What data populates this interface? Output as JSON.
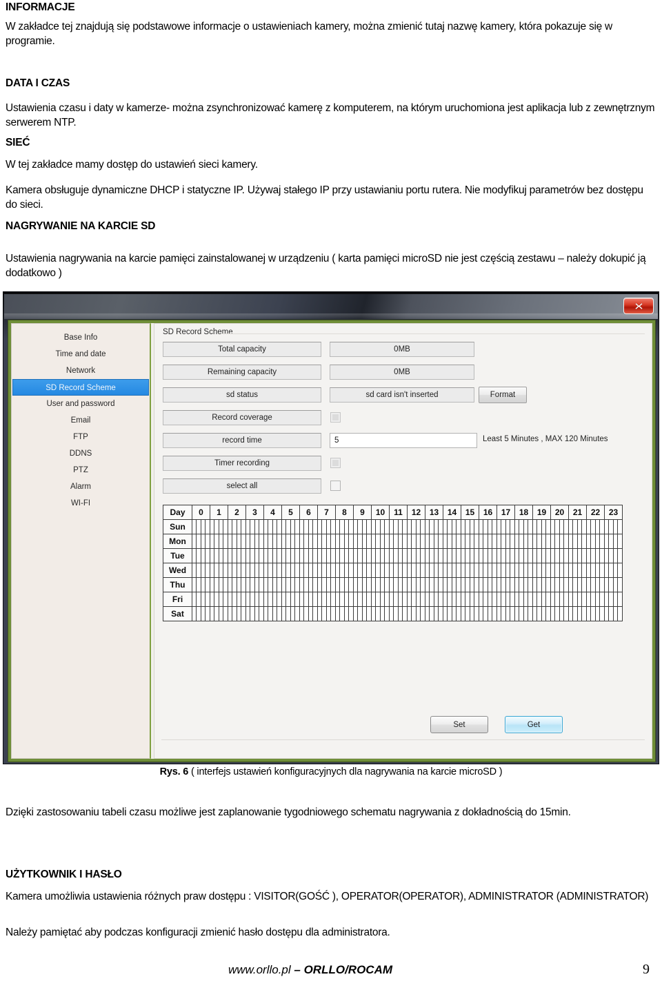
{
  "document": {
    "sections": [
      {
        "id": "informacje",
        "title": "INFORMACJE",
        "body": "W zakładce tej znajdują się podstawowe informacje o ustawieniach kamery, można zmienić tutaj nazwę kamery, która pokazuje się w programie."
      },
      {
        "id": "data_i_czas",
        "title": "DATA I CZAS",
        "body": "Ustawienia czasu i daty w kamerze- można zsynchronizować kamerę z komputerem, na którym uruchomiona jest aplikacja lub z zewnętrznym serwerem NTP."
      },
      {
        "id": "siec",
        "title": "SIEĆ",
        "body1": "W tej zakładce mamy dostęp do ustawień sieci kamery.",
        "body2": "Kamera obsługuje dynamiczne DHCP i statyczne IP. Używaj stałego IP przy ustawianiu portu rutera. Nie modyfikuj parametrów bez dostępu do sieci."
      },
      {
        "id": "nagrywanie_na_karcie_sd",
        "title": "NAGRYWANIE NA KARCIE SD",
        "body": "Ustawienia nagrywania na karcie pamięci zainstalowanej w urządzeniu ( karta pamięci microSD nie jest częścią zestawu – należy dokupić ją dodatkowo )"
      },
      {
        "id": "uzytkownik_i_haslo",
        "title": "UŻYTKOWNIK I HASŁO",
        "body1": "Kamera umożliwia ustawienia różnych praw dostępu : VISITOR(GOŚĆ ), OPERATOR(OPERATOR), ADMINISTRATOR (ADMINISTRATOR)",
        "body2": "Należy pamiętać aby podczas konfiguracji zmienić hasło dostępu dla administratora."
      }
    ],
    "figure_caption_label": "Rys. 6",
    "figure_caption_text": " ( interfejs ustawień konfiguracyjnych  dla nagrywania na karcie microSD )",
    "paragraph_after_figure": "Dzięki zastosowaniu tabeli czasu możliwe jest zaplanowanie tygodniowego schematu nagrywania z dokładnością do 15min.",
    "footer": {
      "site": "www.orllo.pl",
      "brand": " – ORLLO/ROCAM",
      "page_number": "9"
    }
  },
  "app": {
    "window": {
      "close_icon": "close-icon",
      "frame_color": "#6f8e38",
      "titlebar_color": "#3c4250"
    },
    "sidebar": {
      "items": [
        {
          "label": "Base Info",
          "active": false
        },
        {
          "label": "Time and date",
          "active": false
        },
        {
          "label": "Network",
          "active": false
        },
        {
          "label": "SD Record Scheme",
          "active": true
        },
        {
          "label": "User and password",
          "active": false
        },
        {
          "label": "Email",
          "active": false
        },
        {
          "label": "FTP",
          "active": false
        },
        {
          "label": "DDNS",
          "active": false
        },
        {
          "label": "PTZ",
          "active": false
        },
        {
          "label": "Alarm",
          "active": false
        },
        {
          "label": "WI-FI",
          "active": false
        }
      ],
      "active_color": "#2589e2"
    },
    "panel": {
      "title": "SD Record Scheme",
      "fields": [
        {
          "label": "Total capacity",
          "kind": "value",
          "value": "0MB"
        },
        {
          "label": "Remaining capacity",
          "kind": "value",
          "value": "0MB"
        },
        {
          "label": "sd status",
          "kind": "value",
          "value": "sd card isn't inserted",
          "action": "Format"
        },
        {
          "label": "Record coverage",
          "kind": "checkbox",
          "checked": false,
          "dim": true
        },
        {
          "label": "record time",
          "kind": "text",
          "value": "5",
          "hint": "Least 5 Minutes , MAX 120 Minutes"
        },
        {
          "label": "Timer recording",
          "kind": "checkbox",
          "checked": false,
          "dim": true
        },
        {
          "label": "select all",
          "kind": "checkbox",
          "checked": false,
          "dim": false
        }
      ],
      "buttons": {
        "set": "Set",
        "get": "Get"
      }
    },
    "schedule": {
      "day_header": "Day",
      "hours": [
        "0",
        "1",
        "2",
        "3",
        "4",
        "5",
        "6",
        "7",
        "8",
        "9",
        "10",
        "11",
        "12",
        "13",
        "14",
        "15",
        "16",
        "17",
        "18",
        "19",
        "20",
        "21",
        "22",
        "23"
      ],
      "days": [
        "Sun",
        "Mon",
        "Tue",
        "Wed",
        "Thu",
        "Fri",
        "Sat"
      ],
      "slots_per_hour": 4,
      "selected_slots": []
    }
  }
}
